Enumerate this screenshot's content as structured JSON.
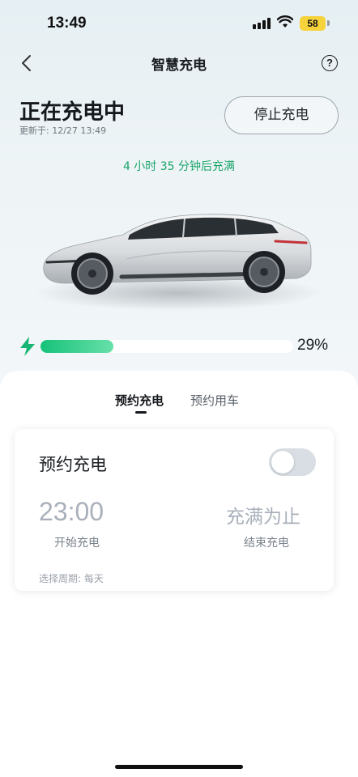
{
  "status_bar": {
    "time": "13:49",
    "battery_level": "58",
    "icons": [
      "signal-icon",
      "wifi-icon",
      "battery-icon"
    ]
  },
  "nav": {
    "back_icon": "chevron-left-icon",
    "title": "智慧充电",
    "help_label": "?"
  },
  "charging": {
    "status_title": "正在充电中",
    "update_time": "更新于: 12/27 13:49",
    "stop_button_label": "停止充电",
    "remaining_text": "4 小时 35 分钟后充满",
    "progress_fraction": 0.29,
    "progress_text": "29%"
  },
  "tabs": [
    {
      "label": "预约充电",
      "active": true
    },
    {
      "label": "预约用车",
      "active": false
    }
  ],
  "schedule_card": {
    "title": "预约充电",
    "toggle_on": false,
    "start_time": "23:00",
    "start_label": "开始充电",
    "end_value": "充满为止",
    "end_label": "结束充电",
    "cycle_text": "选择周期: 每天"
  },
  "colors": {
    "accent_green": "#1aa56a",
    "progress_start": "#16c27a",
    "progress_end": "#68e0a9",
    "battery_badge": "#f6d33b"
  }
}
